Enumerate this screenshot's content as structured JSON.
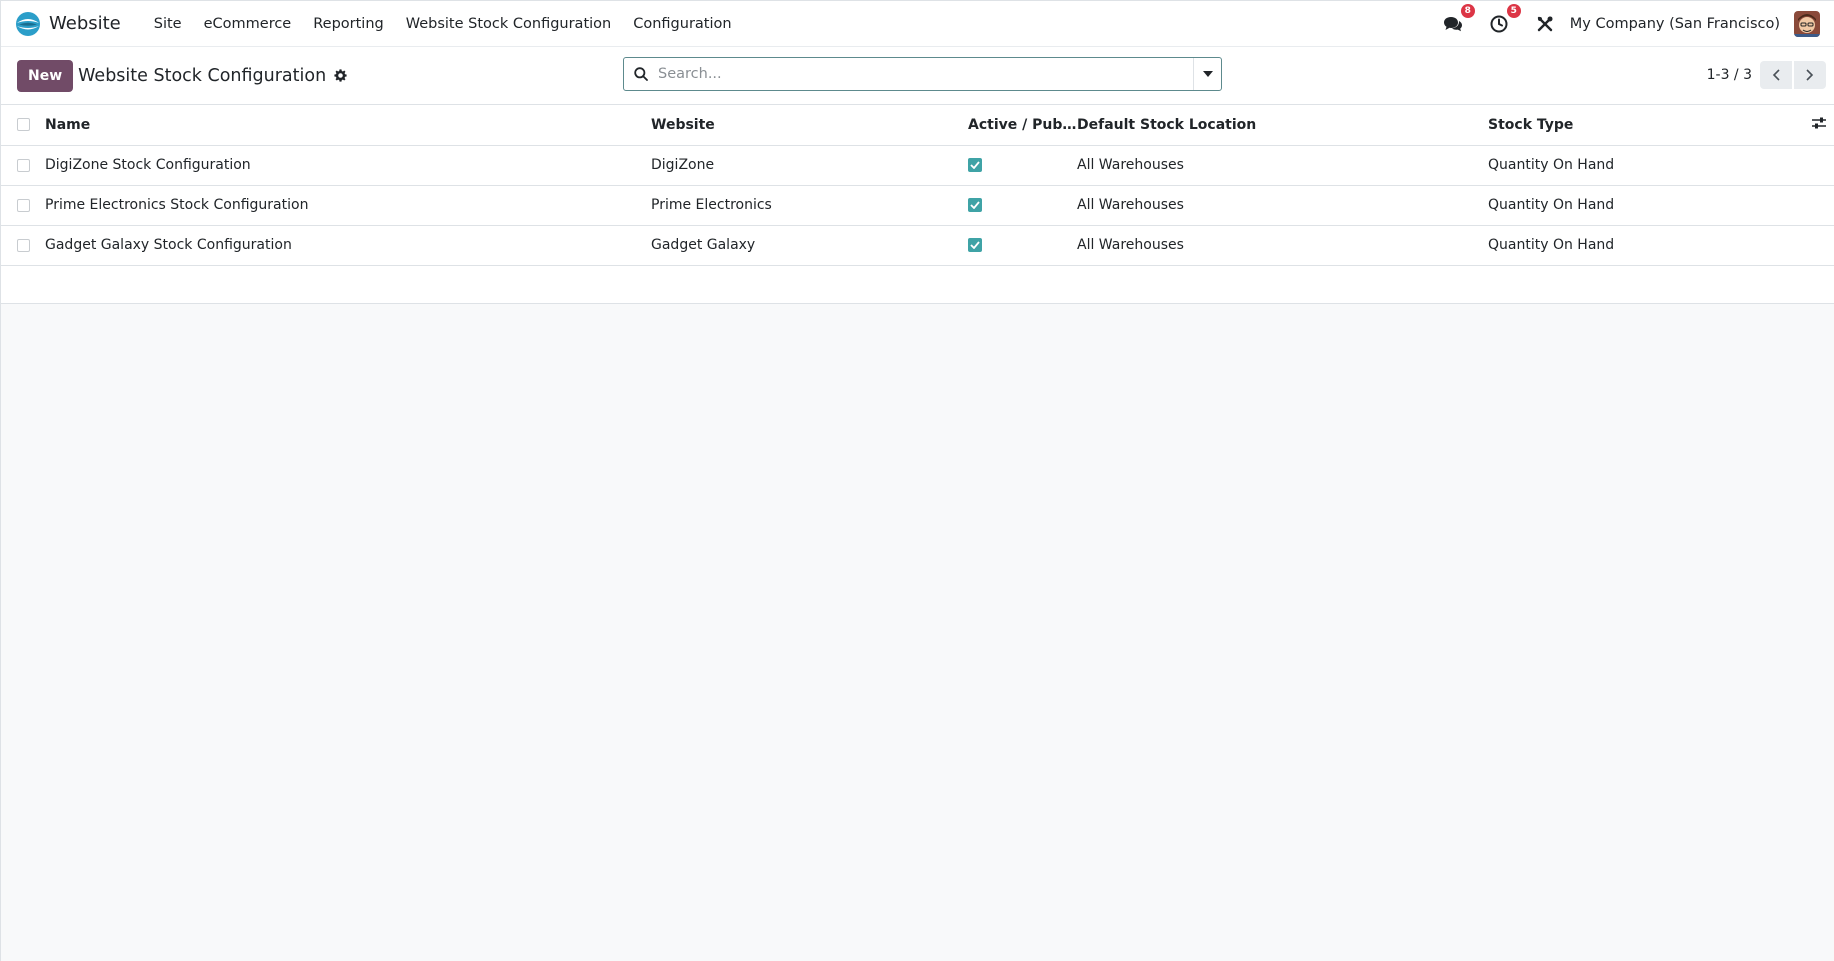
{
  "navbar": {
    "app_name": "Website",
    "menu": [
      "Site",
      "eCommerce",
      "Reporting",
      "Website Stock Configuration",
      "Configuration"
    ],
    "messages_badge": "8",
    "activities_badge": "5",
    "company": "My Company (San Francisco)"
  },
  "control_panel": {
    "new_label": "New",
    "title": "Website Stock Configuration",
    "search_placeholder": "Search...",
    "pager": "1-3 / 3"
  },
  "table": {
    "headers": {
      "name": "Name",
      "website": "Website",
      "active": "Active / Pub...",
      "location": "Default Stock Location",
      "type": "Stock Type"
    },
    "rows": [
      {
        "name": "DigiZone Stock Configuration",
        "website": "DigiZone",
        "active": true,
        "location": "All Warehouses",
        "type": "Quantity On Hand"
      },
      {
        "name": "Prime Electronics Stock Configuration",
        "website": "Prime Electronics",
        "active": true,
        "location": "All Warehouses",
        "type": "Quantity On Hand"
      },
      {
        "name": "Gadget Galaxy Stock Configuration",
        "website": "Gadget Galaxy",
        "active": true,
        "location": "All Warehouses",
        "type": "Quantity On Hand"
      }
    ]
  },
  "colors": {
    "brand": "#714b67",
    "checkbox": "#3fa3a6",
    "badge": "#dc3545"
  },
  "icons": {
    "messages": "chat-icon",
    "activities": "clock-icon",
    "debug": "tools-icon",
    "settings": "gear-icon",
    "search": "search-icon",
    "optional_columns": "sliders-icon"
  }
}
